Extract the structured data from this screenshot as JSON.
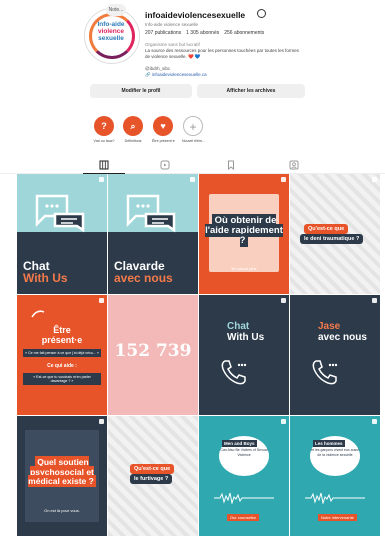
{
  "profile": {
    "note": "Note...",
    "avatar_line1": "Info-aide",
    "avatar_line2": "violence",
    "avatar_line3": "sexuelle",
    "username": "infoaideviolencesexuelle",
    "subtitle": "Info-aide violence sexuelle",
    "stats": {
      "posts": "207 publications",
      "followers": "1 305 abonnés",
      "following": "256 abonnements"
    },
    "category": "Organisme sans but lucratif",
    "bio": "La source des ressources pour les personnes touchées par toutes les formes de violence sexuelle. ❤️ 💙",
    "handle": "@ibdrh_sibc",
    "link": "🔗 infoaideviolencesexuelle.ca",
    "edit_button": "Modifier le profil",
    "archive_button": "Afficher les archives"
  },
  "highlights": [
    {
      "label": "Vrai ou faux?",
      "glyph": "?",
      "icon": "question-icon"
    },
    {
      "label": "Définitions",
      "glyph": "⌕",
      "icon": "search-icon"
    },
    {
      "label": "Être présent·e",
      "glyph": "♥",
      "icon": "heart-icon"
    },
    {
      "label": "Nouvel élém...",
      "glyph": "+",
      "icon": "plus-icon"
    }
  ],
  "tabs": [
    {
      "name": "grid",
      "icon": "grid-icon"
    },
    {
      "name": "reels",
      "icon": "reels-icon"
    },
    {
      "name": "saved",
      "icon": "bookmark-icon"
    },
    {
      "name": "tagged",
      "icon": "tagged-icon"
    }
  ],
  "posts": {
    "p1": {
      "title_a": "Chat",
      "title_b": "With Us"
    },
    "p2": {
      "title_a": "Clavarde",
      "title_b": "avec nous"
    },
    "p3": {
      "title": "Où obtenir de l'aide rapidement ?",
      "note": "En savoir plus"
    },
    "p4": {
      "pill_a": "Qu'est-ce que",
      "pill_b": "le deni traumatique ?"
    },
    "p5": {
      "title_a": "Être",
      "title_b": "présent·e",
      "q1": "« Ce me fait penser à ce que j'ai déjà vécu... »",
      "heading": "Ce qui aide :",
      "q2": "« Est-ce que tu voudrais m'en parler davantage ? »"
    },
    "p6": {
      "number": "152 739"
    },
    "p7": {
      "title_a": "Chat",
      "title_b": "With Us"
    },
    "p8": {
      "title_a": "Jase",
      "title_b": "avec nous"
    },
    "p9": {
      "title": "Quel soutien psychosocial et médical existe ?",
      "note": "On est là pour vous."
    },
    "p10": {
      "pill_a": "Qu'est-ce que",
      "pill_b": "le furtivage ?"
    },
    "p11": {
      "head": "Men and Boys",
      "sub": "Can Also Be Victims of Sexual Violence",
      "foot": "Our counsellor"
    },
    "p12": {
      "head": "Les hommes",
      "sub": "et les garçons vivent eux aussi de la violence sexuelle",
      "foot": "Notre intervenante"
    }
  }
}
